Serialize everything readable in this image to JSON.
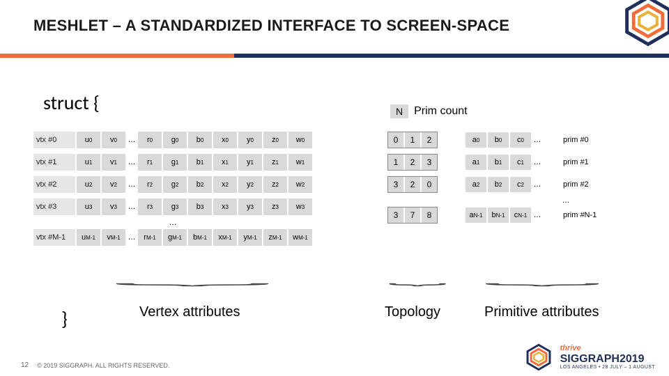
{
  "title": "MESHLET – A STANDARDIZED INTERFACE TO SCREEN-SPACE",
  "struct_open": "struct {",
  "struct_close": "}",
  "prim_header": {
    "n": "N",
    "label": "Prim count"
  },
  "vertex": {
    "rows": [
      {
        "label": "vtx #0",
        "cells": [
          "u<sub>0</sub>",
          "v<sub>0</sub>",
          "…",
          "r<sub>0</sub>",
          "g<sub>0</sub>",
          "b<sub>0</sub>",
          "x<sub>0</sub>",
          "y<sub>0</sub>",
          "z<sub>0</sub>",
          "w<sub>0</sub>"
        ]
      },
      {
        "label": "vtx #1",
        "cells": [
          "u<sub>1</sub>",
          "v<sub>1</sub>",
          "…",
          "r<sub>1</sub>",
          "g<sub>1</sub>",
          "b<sub>1</sub>",
          "x<sub>1</sub>",
          "y<sub>1</sub>",
          "z<sub>1</sub>",
          "w<sub>1</sub>"
        ]
      },
      {
        "label": "vtx #2",
        "cells": [
          "u<sub>2</sub>",
          "v<sub>2</sub>",
          "…",
          "r<sub>2</sub>",
          "g<sub>2</sub>",
          "b<sub>2</sub>",
          "x<sub>2</sub>",
          "y<sub>2</sub>",
          "z<sub>2</sub>",
          "w<sub>2</sub>"
        ]
      },
      {
        "label": "vtx #3",
        "cells": [
          "u<sub>3</sub>",
          "v<sub>3</sub>",
          "…",
          "r<sub>3</sub>",
          "g<sub>3</sub>",
          "b<sub>3</sub>",
          "x<sub>3</sub>",
          "y<sub>3</sub>",
          "z<sub>3</sub>",
          "w<sub>3</sub>"
        ]
      }
    ],
    "vdots": "…",
    "last_row": {
      "label": "vtx #M-1",
      "cells": [
        "u<sub>M-1</sub>",
        "v<sub>M-1</sub>",
        "…",
        "r<sub>M-1</sub>",
        "g<sub>M-1</sub>",
        "b<sub>M-1</sub>",
        "x<sub>M-1</sub>",
        "y<sub>M-1</sub>",
        "z<sub>M-1</sub>",
        "w<sub>M-1</sub>"
      ]
    }
  },
  "section_va": "Vertex attributes",
  "prim": {
    "rows": [
      {
        "tri": [
          "0",
          "1",
          "2"
        ],
        "attrs": [
          "a<sub>0</sub>",
          "b<sub>0</sub>",
          "c<sub>0</sub>"
        ],
        "label": "prim #0"
      },
      {
        "tri": [
          "1",
          "2",
          "3"
        ],
        "attrs": [
          "a<sub>1</sub>",
          "b<sub>1</sub>",
          "c<sub>1</sub>"
        ],
        "label": "prim #1"
      },
      {
        "tri": [
          "3",
          "2",
          "0"
        ],
        "attrs": [
          "a<sub>2</sub>",
          "b<sub>2</sub>",
          "c<sub>2</sub>"
        ],
        "label": "prim #2"
      }
    ],
    "vdots": "…",
    "last_row": {
      "tri": [
        "3",
        "7",
        "8"
      ],
      "attrs": [
        "a<sub>N-1</sub>",
        "b<sub>N-1</sub>",
        "c<sub>N-1</sub>"
      ],
      "label": "prim #N-1"
    },
    "adots": "…"
  },
  "section_topo": "Topology",
  "section_pa": "Primitive attributes",
  "footer": {
    "page": "12",
    "copyright": "© 2019 SIGGRAPH. ALL RIGHTS RESERVED."
  },
  "logo": {
    "thrive": "thrive",
    "name": "SIGGRAPH2019",
    "sub": "LOS ANGELES  •  28 JULY – 1 AUGUST"
  }
}
